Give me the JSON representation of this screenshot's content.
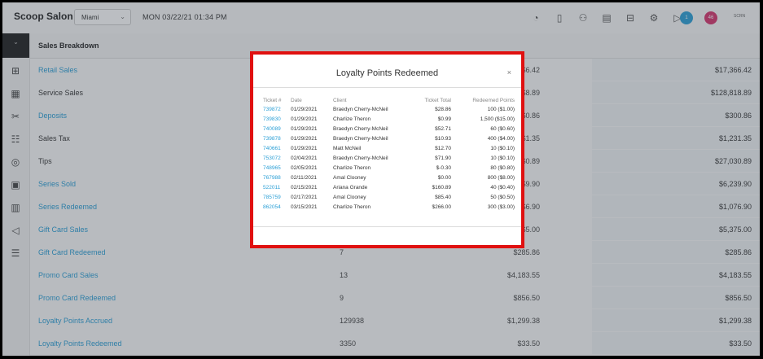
{
  "topbar": {
    "brand": "Scoop Salon",
    "location": "Miami",
    "datetime": "MON 03/22/21  01:34 PM",
    "icons": [
      "speedometer-icon",
      "book-icon",
      "group-icon",
      "clipboard-icon",
      "drawer-icon",
      "settings-icon",
      "play-icon"
    ],
    "avatar1": "1",
    "avatar2": "46",
    "right_text": "SCRN"
  },
  "sidenav": {
    "icons": [
      "add-box-icon",
      "calendar-icon",
      "scissors-icon",
      "people-icon",
      "user-circle-icon",
      "calendar-icon",
      "chart-icon",
      "megaphone-icon",
      "sliders-icon"
    ]
  },
  "table": {
    "header": "Sales Breakdown",
    "rows": [
      {
        "label": "Retail Sales",
        "link": true,
        "count": "",
        "amount": "$6.42",
        "total": "$17,366.42"
      },
      {
        "label": "Service Sales",
        "link": false,
        "count": "",
        "amount": "$8.89",
        "total": "$128,818.89"
      },
      {
        "label": "Deposits",
        "link": true,
        "count": "",
        "amount": "$0.86",
        "total": "$300.86"
      },
      {
        "label": "Sales Tax",
        "link": false,
        "count": "",
        "amount": "$1.35",
        "total": "$1,231.35"
      },
      {
        "label": "Tips",
        "link": false,
        "count": "",
        "amount": "$0.89",
        "total": "$27,030.89"
      },
      {
        "label": "Series Sold",
        "link": true,
        "count": "",
        "amount": "$9.90",
        "total": "$6,239.90"
      },
      {
        "label": "Series Redeemed",
        "link": true,
        "count": "",
        "amount": "$6.90",
        "total": "$1,076.90"
      },
      {
        "label": "Gift Card Sales",
        "link": true,
        "count": "",
        "amount": "$5.00",
        "total": "$5,375.00"
      },
      {
        "label": "Gift Card Redeemed",
        "link": true,
        "count": "7",
        "amount": "$285.86",
        "total": "$285.86"
      },
      {
        "label": "Promo Card Sales",
        "link": true,
        "count": "13",
        "amount": "$4,183.55",
        "total": "$4,183.55"
      },
      {
        "label": "Promo Card Redeemed",
        "link": true,
        "count": "9",
        "amount": "$856.50",
        "total": "$856.50"
      },
      {
        "label": "Loyalty Points Accrued",
        "link": true,
        "count": "129938",
        "amount": "$1,299.38",
        "total": "$1,299.38"
      },
      {
        "label": "Loyalty Points Redeemed",
        "link": true,
        "count": "3350",
        "amount": "$33.50",
        "total": "$33.50"
      }
    ]
  },
  "modal": {
    "title": "Loyalty Points Redeemed",
    "close": "×",
    "columns": [
      "Ticket #",
      "Date",
      "Client",
      "Ticket Total",
      "Redeemed Points"
    ],
    "rows": [
      {
        "ticket": "739872",
        "date": "01/29/2021",
        "client": "Braedyn Cherry-McNeil",
        "total": "$28.86",
        "points": "100 ($1.00)"
      },
      {
        "ticket": "739830",
        "date": "01/29/2021",
        "client": "Charlize Theron",
        "total": "$0.99",
        "points": "1,500 ($15.00)"
      },
      {
        "ticket": "740089",
        "date": "01/29/2021",
        "client": "Braedyn Cherry-McNeil",
        "total": "$52.71",
        "points": "60 ($0.60)"
      },
      {
        "ticket": "739878",
        "date": "01/29/2021",
        "client": "Braedyn Cherry-McNeil",
        "total": "$10.93",
        "points": "400 ($4.00)"
      },
      {
        "ticket": "740661",
        "date": "01/29/2021",
        "client": "Matt McNeil",
        "total": "$12.70",
        "points": "10 ($0.10)"
      },
      {
        "ticket": "753072",
        "date": "02/04/2021",
        "client": "Braedyn Cherry-McNeil",
        "total": "$71.90",
        "points": "10 ($0.10)"
      },
      {
        "ticket": "748965",
        "date": "02/05/2021",
        "client": "Charlize Theron",
        "total": "$-0.30",
        "points": "80 ($0.80)"
      },
      {
        "ticket": "767988",
        "date": "02/11/2021",
        "client": "Amal Clooney",
        "total": "$0.00",
        "points": "800 ($8.00)"
      },
      {
        "ticket": "522011",
        "date": "02/15/2021",
        "client": "Ariana Grande",
        "total": "$160.89",
        "points": "40 ($0.40)"
      },
      {
        "ticket": "785759",
        "date": "02/17/2021",
        "client": "Amal Clooney",
        "total": "$85.40",
        "points": "50 ($0.50)"
      },
      {
        "ticket": "862054",
        "date": "03/15/2021",
        "client": "Charlize Theron",
        "total": "$266.00",
        "points": "300 ($3.00)"
      }
    ]
  },
  "colors": {
    "link": "#2a9fd6",
    "highlight_border": "#e01010",
    "avatar1": "#2a9fd6",
    "avatar2": "#d6336c"
  }
}
